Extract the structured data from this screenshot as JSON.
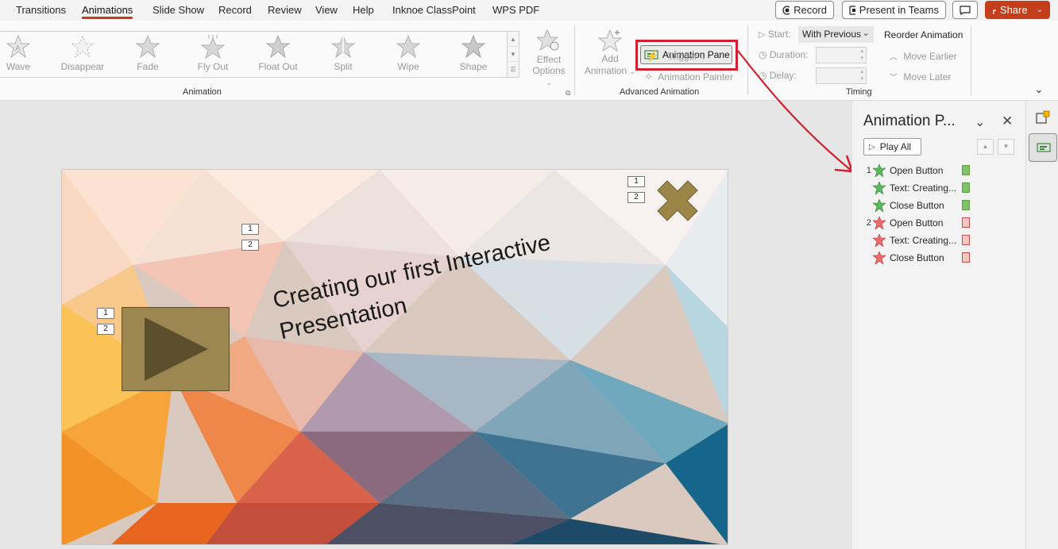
{
  "tabs": [
    "Transitions",
    "Animations",
    "Slide Show",
    "Record",
    "Review",
    "View",
    "Help",
    "Inknoe ClassPoint",
    "WPS PDF"
  ],
  "active_tab": "Animations",
  "top_buttons": {
    "record": "Record",
    "present_in_teams": "Present in Teams",
    "share": "Share"
  },
  "ribbon": {
    "animations": [
      "Wave",
      "Disappear",
      "Fade",
      "Fly Out",
      "Float Out",
      "Split",
      "Wipe",
      "Shape"
    ],
    "effect_options": {
      "line1": "Effect",
      "line2": "Options"
    },
    "group_animation": "Animation",
    "add_animation": {
      "line1": "Add",
      "line2": "Animation"
    },
    "animation_pane": "Animation Pane",
    "trigger": "Trigger",
    "animation_painter": "Animation Painter",
    "group_advanced": "Advanced Animation",
    "start_label": "Start:",
    "start_value": "With Previous",
    "duration_label": "Duration:",
    "delay_label": "Delay:",
    "group_timing": "Timing",
    "reorder_title": "Reorder Animation",
    "move_earlier": "Move Earlier",
    "move_later": "Move Later"
  },
  "slide": {
    "title": "Creating our first Interactive Presentation",
    "tags": [
      "1",
      "2"
    ]
  },
  "pane": {
    "title": "Animation P...",
    "play_all": "Play All",
    "items": [
      {
        "num": "1",
        "label": "Open Button",
        "type": "entrance"
      },
      {
        "num": "",
        "label": "Text: Creating...",
        "type": "entrance"
      },
      {
        "num": "",
        "label": "Close Button",
        "type": "entrance"
      },
      {
        "num": "2",
        "label": "Open Button",
        "type": "exit"
      },
      {
        "num": "",
        "label": "Text: Creating...",
        "type": "exit"
      },
      {
        "num": "",
        "label": "Close Button",
        "type": "exit"
      }
    ]
  },
  "colors": {
    "accent": "#c43e1c",
    "highlight": "#d32030",
    "entrance": "#4caf50",
    "exit": "#e53935"
  }
}
